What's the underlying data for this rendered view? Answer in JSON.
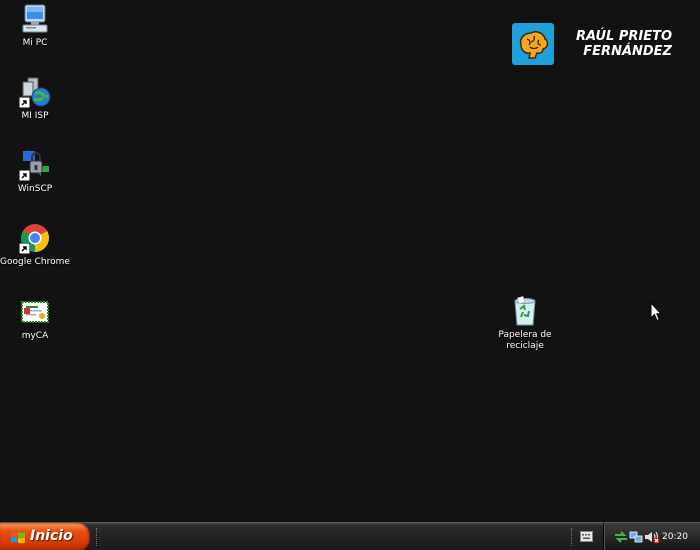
{
  "desktop": {
    "icons": [
      {
        "label": "Mi PC",
        "icon": "my-computer-icon"
      },
      {
        "label": "MI ISP",
        "icon": "network-globe-icon"
      },
      {
        "label": "WinSCP",
        "icon": "winscp-icon"
      },
      {
        "label": "Google Chrome",
        "icon": "chrome-icon"
      },
      {
        "label": "myCA",
        "icon": "certificate-icon"
      }
    ],
    "recycle_bin": {
      "label_line1": "Papelera de",
      "label_line2": "reciclaje",
      "icon": "recycle-bin-icon"
    }
  },
  "brand": {
    "line1": "RAÚL PRIETO",
    "line2": "FERNÁNDEZ",
    "accent": "#1fa0d8",
    "mark_color": "#f5a623"
  },
  "taskbar": {
    "start_label": "Inicio",
    "start_color": "#e84e10",
    "clock": "20:20"
  }
}
